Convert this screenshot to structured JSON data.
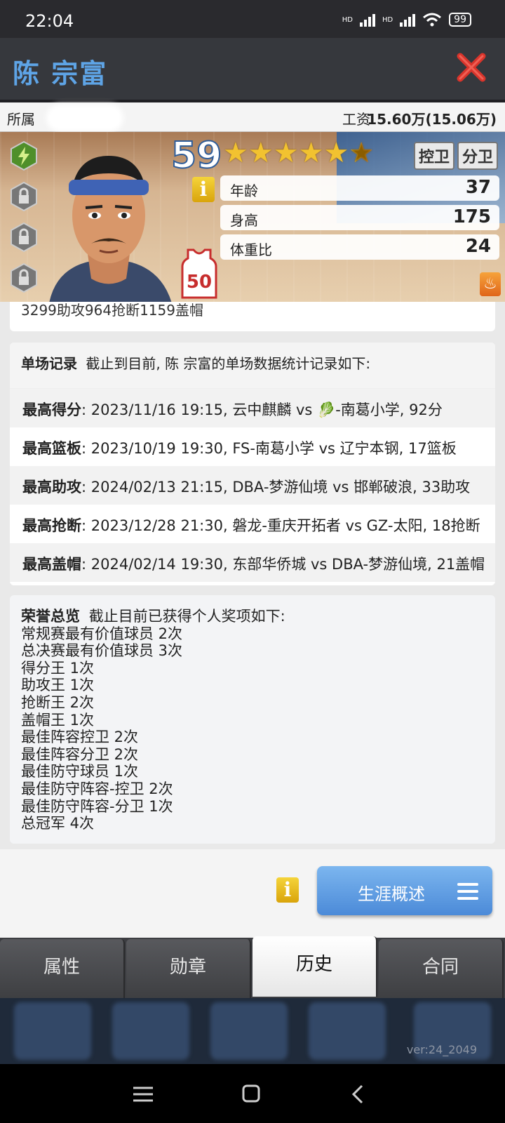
{
  "status": {
    "time": "22:04",
    "battery": "99",
    "hd1": "HD",
    "hd2": "HD"
  },
  "title": {
    "player_name": "陈 宗富"
  },
  "affiliation": {
    "label": "所属",
    "wage_label": "工资",
    "wage_value": "15.60万(15.06万)"
  },
  "hero": {
    "rating": "59",
    "stars": 5.5,
    "positions": [
      "控卫",
      "分卫"
    ],
    "info_glyph": "i",
    "stats": [
      {
        "key": "年龄",
        "value": "37"
      },
      {
        "key": "身高",
        "value": "175"
      },
      {
        "key": "体重比",
        "value": "24"
      }
    ],
    "jersey_number": "50"
  },
  "career_tail": "3299助攻964抢断1159盖帽",
  "records": {
    "title": "单场记录",
    "intro": "截止到目前, 陈 宗富的单场数据统计记录如下:",
    "rows": [
      {
        "label": "最高得分",
        "text": ": 2023/11/16 19:15, 云中麒麟 vs 🥬-南葛小学, 92分"
      },
      {
        "label": "最高篮板",
        "text": ": 2023/10/19 19:30, FS-南葛小学 vs 辽宁本钢, 17篮板"
      },
      {
        "label": "最高助攻",
        "text": ": 2024/02/13 21:15, DBA-梦游仙境 vs 邯郸破浪, 33助攻"
      },
      {
        "label": "最高抢断",
        "text": ": 2023/12/28 21:30, 磐龙-重庆开拓者 vs GZ-太阳, 18抢断"
      },
      {
        "label": "最高盖帽",
        "text": ": 2024/02/14 19:30, 东部华侨城 vs DBA-梦游仙境, 21盖帽"
      }
    ]
  },
  "honors": {
    "title": "荣誉总览",
    "intro": "截止目前已获得个人奖项如下:",
    "items": [
      "常规赛最有价值球员  2次",
      "总决赛最有价值球员  3次",
      "得分王  1次",
      "助攻王  1次",
      "抢断王  2次",
      "盖帽王  1次",
      "最佳阵容控卫  2次",
      "最佳阵容分卫  2次",
      "最佳防守球员  1次",
      "最佳防守阵容-控卫  2次",
      "最佳防守阵容-分卫  1次",
      "总冠军  4次"
    ]
  },
  "career_button": {
    "label": "生涯概述"
  },
  "tabs": [
    {
      "label": "属性",
      "active": false
    },
    {
      "label": "勋章",
      "active": false
    },
    {
      "label": "历史",
      "active": true
    },
    {
      "label": "合同",
      "active": false
    }
  ],
  "version": "ver:24_2049",
  "colors": {
    "accent_blue": "#5ea4e6",
    "close_red": "#d9342b",
    "button_blue": "#4b8ad8"
  }
}
